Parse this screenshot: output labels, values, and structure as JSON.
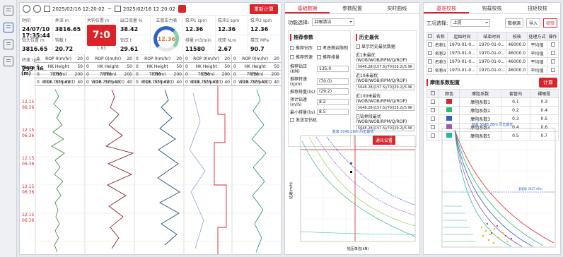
{
  "toolbar": {
    "start_date": "2025/02/16 12:20:02",
    "separator": "~",
    "end_date": "2025/02/16 12:20:02",
    "recalc": "重新计算"
  },
  "metrics": [
    {
      "label": "时间",
      "value": "24/07/10 17:35:44"
    },
    {
      "label": "井深 m",
      "value": "3816.65"
    },
    {
      "label": "出口流量 %",
      "value": "38.42"
    },
    {
      "label": "泵冲1 spm",
      "value": "12.36"
    },
    {
      "label": "泵冲2 spm",
      "value": "12.36"
    },
    {
      "label": "泵冲3 spm",
      "value": "12.36"
    },
    {
      "label": "钻头位置 m",
      "value": "3816.65"
    },
    {
      "label": "钩载 t",
      "value": "20.72"
    },
    {
      "label": "钻压 t",
      "value": "29.61"
    },
    {
      "label": "排量 m3/min",
      "value": "11580"
    },
    {
      "label": "扭矩 N.m",
      "value": "2.67"
    },
    {
      "label": "泵压 MPa",
      "value": "90.7"
    },
    {
      "label": "转速 rpm",
      "value": "299.36"
    }
  ],
  "dial": {
    "label": "大钩位置 m",
    "value": "7:0",
    "bottom": "1.63"
  },
  "gauge": {
    "label": "立管压力表",
    "value": "12.36"
  },
  "tracks": [
    {
      "rows": [
        [
          "0",
          "ROP 0(m/hr)",
          "20"
        ],
        [
          "0",
          "HK Height 7.01(m)",
          "50"
        ],
        [
          "0",
          "RPM 111.75(rpm)",
          "200"
        ],
        [
          "0",
          "WOB -373.42(t)",
          "40"
        ]
      ]
    },
    {
      "rows": [
        [
          "0",
          "ROP 0(m/hr)",
          "20"
        ],
        [
          "0",
          "HK Height 7.01(m)",
          "50"
        ],
        [
          "0",
          "RPM 111.75(rpm)",
          "200"
        ],
        [
          "0",
          "WOB -373.42(t)",
          "40"
        ]
      ]
    },
    {
      "rows": [
        [
          "0",
          "ROP 0(m/hr)",
          "20"
        ],
        [
          "0",
          "HK Height 7.01(m)",
          "50"
        ],
        [
          "0",
          "RPM 111.75(rpm)",
          "200"
        ],
        [
          "0",
          "WOB -373.42(t)",
          "40"
        ]
      ]
    },
    {
      "rows": [
        [
          "0",
          "ROP 0(m/hr)",
          "20"
        ],
        [
          "0",
          "HK Height 7.01(m)",
          "50"
        ],
        [
          "0",
          "RPM 111.75(rpm)",
          "200"
        ],
        [
          "0",
          "WOB -373.42(t)",
          "40"
        ]
      ]
    },
    {
      "rows": [
        [
          "0",
          "ROP 0(m/hr)",
          "20"
        ],
        [
          "0",
          "HK Height 7.01(m)",
          "50"
        ],
        [
          "0",
          "RPM 111.75(rpm)",
          "200"
        ],
        [
          "0",
          "WOB -373.42(t)",
          "40"
        ]
      ]
    }
  ],
  "time_label": "Time (m)",
  "time_ticks": [
    "12:15\n06:36",
    "12:15\n06:36",
    "12:15\n06:36",
    "12:15\n06:36",
    "12:15\n06:36",
    "12:15\n06:36"
  ],
  "middle": {
    "tabs": [
      "基础数据",
      "参数配置",
      "实时曲线"
    ],
    "fn_label": "功能选择:",
    "fn_value": "井眼清洁",
    "rec_title": "推荐参数",
    "checks": [
      "推荐钻压",
      "考虑携岩限制",
      "推荐转速",
      "推荐排量"
    ],
    "fields": [
      [
        "推荐钻压(KM)",
        "135.0"
      ],
      [
        "推荐转速(rpm)",
        "(70.0)"
      ],
      [
        "推荐排量(l/s)",
        "(29.2)"
      ],
      [
        "预计钻速(m/h)",
        "8.2"
      ],
      [
        "最小排量(l/s)",
        "8.5"
      ]
    ],
    "send_check": "发送至钻机",
    "hist_title": "历史最优",
    "hist_check": "显示历史最优数据",
    "hist": [
      [
        "近1米最优(WOB/WOB/RPM/Q/ROP)",
        "5048.28/|157.5|/70/|29.2|/5.96"
      ],
      [
        "近10米最优(WOB/WOB/RPM/Q/ROP)",
        "5048.28/|157.5|/70/|29.2|/5.96"
      ],
      [
        "近100米最优(WOB/WOB/RPM/Q/ROP)",
        "5048.28/|157.5|/70/|29.2|/5.96"
      ],
      [
        "已钻井段最优(WOB/WOB/RPM/Q/ROP)",
        "5048.28/|157.5|/70/|29.2|/5.96"
      ]
    ],
    "settings_btn": "通讯设置",
    "chart_title": "基准 5048.28m 历史最优",
    "xlabel": "钻压单位(kN)",
    "ylabel": "钻速(m/h)"
  },
  "right": {
    "tabs": [
      "基准校核",
      "钩载校核",
      "扭矩校核"
    ],
    "cond_label": "工况选择:",
    "cond_value": "上提",
    "btns": [
      "数据源",
      "导入",
      "校验"
    ],
    "t1_headers": [
      "名称",
      "起始时间",
      "结束时间",
      "校核",
      "处理方式",
      "操作"
    ],
    "t1_rows": [
      [
        "名称1",
        "1970-01-0...",
        "1970-01-0...",
        "46000.0",
        "平均值"
      ],
      [
        "名称2",
        "1970-01-0...",
        "1970-01-0...",
        "46000.0",
        "平均值"
      ],
      [
        "名称3",
        "1970-01-0...",
        "1970-01-0...",
        "46000.0",
        "平均值"
      ],
      [
        "名称4",
        "1970-01-0...",
        "1970-01-0...",
        "46000.0",
        "平均值"
      ]
    ],
    "fr_title": "摩阻系数配置",
    "calc_btn": "计算",
    "t2_headers": [
      "颜色",
      "摩阻系数",
      "套管内",
      "裸眼段"
    ],
    "t2_rows": [
      [
        "#d9242b",
        "摩阻系数1",
        "0.1",
        "0.3"
      ],
      [
        "#2eb873",
        "摩阻系数2",
        "0.2",
        "0.4"
      ],
      [
        "#2f62c7",
        "摩阻系数3",
        "0.3",
        "0.5"
      ],
      [
        "#9b59b6",
        "摩阻系数4",
        "0.4",
        "0.6"
      ],
      [
        "#1abc9c",
        "摩阻系数5",
        "0.5",
        "0.7"
      ]
    ],
    "chart_title": "基准 5048.28m 历史最优",
    "note": "套管鞋 3027.49m"
  }
}
